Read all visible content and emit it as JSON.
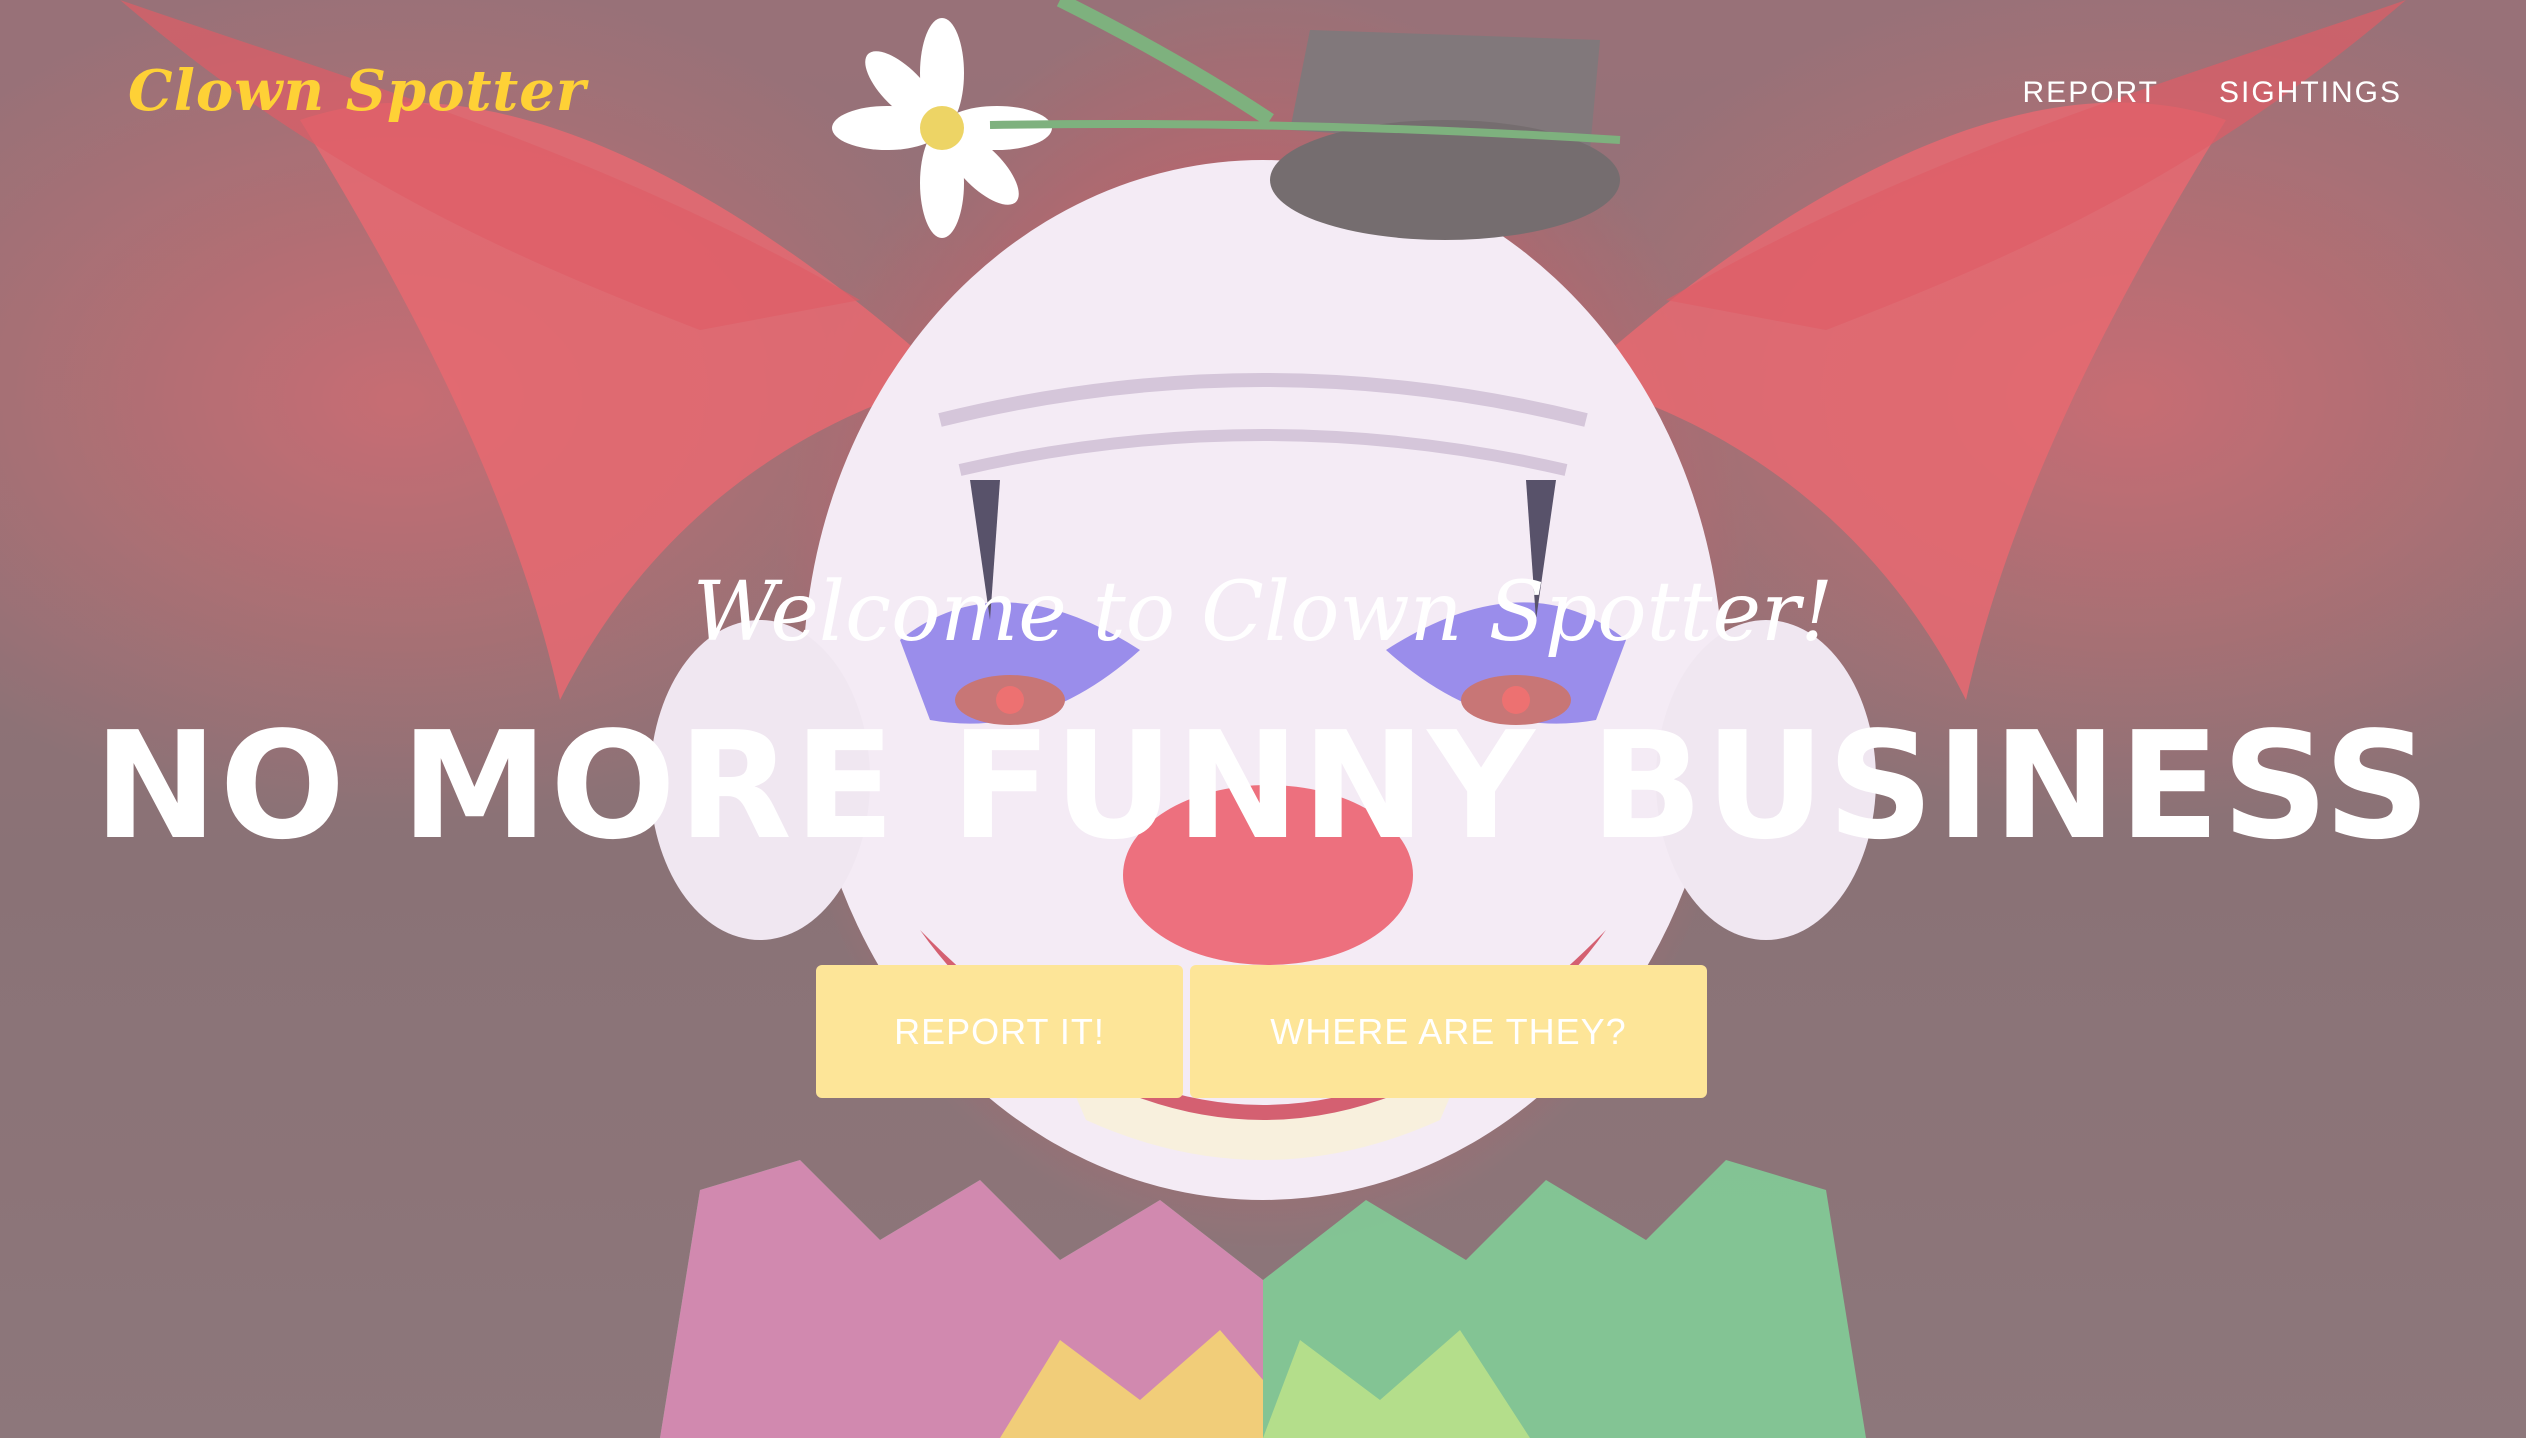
{
  "nav": {
    "brand": "Clown Spotter",
    "links": [
      "REPORT",
      "SIGHTINGS"
    ]
  },
  "hero": {
    "lead_in": "Welcome to Clown Spotter!",
    "heading": "NO MORE FUNNY BUSINESS",
    "background_image": "scary-clown-illustration",
    "buttons": {
      "report": "REPORT IT!",
      "where": "WHERE ARE THEY?"
    }
  },
  "colors": {
    "brand": "#fed136",
    "button_bg": "#fde598",
    "text": "#ffffff"
  }
}
